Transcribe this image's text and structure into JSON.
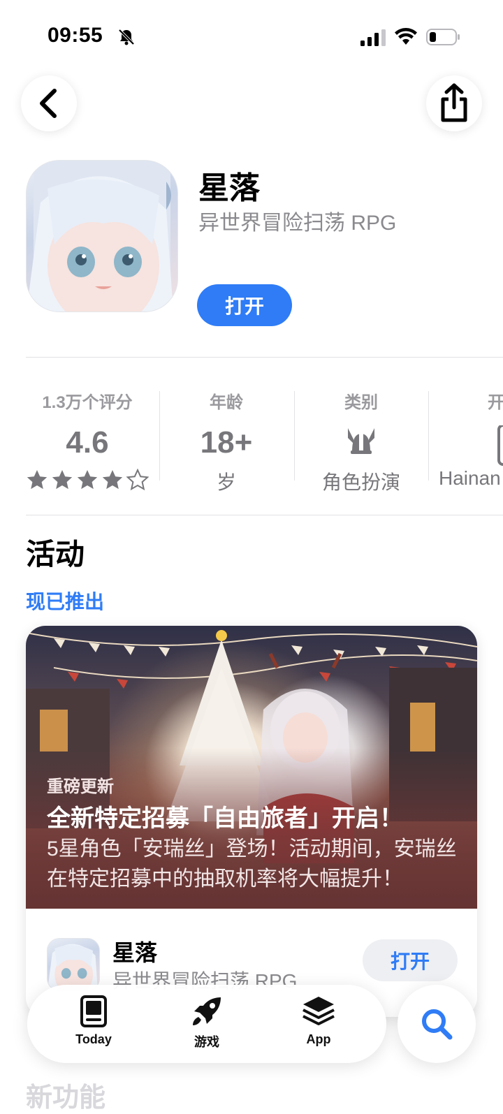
{
  "status_bar": {
    "time": "09:55"
  },
  "app": {
    "title": "星落",
    "subtitle": "异世界冒险扫荡 RPG",
    "open_label": "打开"
  },
  "info": {
    "ratings": {
      "label": "1.3万个评分",
      "value": "4.6",
      "stars": 4.6
    },
    "age": {
      "label": "年龄",
      "value": "18+",
      "foot": "岁"
    },
    "category": {
      "label": "类别",
      "foot": "角色扮演"
    },
    "developer": {
      "label": "开",
      "foot": "Hainan"
    }
  },
  "events": {
    "title": "活动",
    "link": "现已推出",
    "card": {
      "kicker": "重磅更新",
      "headline": "全新特定招募「自由旅者」开启！",
      "description": "5星角色「安瑞丝」登场！活动期间，安瑞丝在特定招募中的抽取机率将大幅提升！",
      "app_title": "星落",
      "app_subtitle": "异世界冒险扫荡 RPG",
      "open_label": "打开"
    }
  },
  "next_section_peek": "新功能",
  "tabbar": {
    "today": "Today",
    "games": "游戏",
    "apps": "App"
  },
  "colors": {
    "accent": "#2f7cf6",
    "secondary_text": "#8a8a8e"
  }
}
